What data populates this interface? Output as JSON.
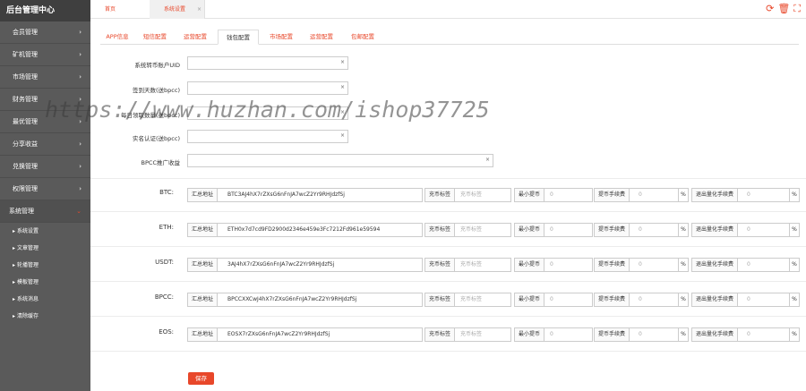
{
  "sidebar": {
    "title": "后台管理中心",
    "menu": [
      {
        "label": "会员管理",
        "icon": "chevron-right-icon"
      },
      {
        "label": "矿机管理",
        "icon": "chevron-right-icon"
      },
      {
        "label": "市场管理",
        "icon": "chevron-right-icon"
      },
      {
        "label": "财务管理",
        "icon": "chevron-right-icon"
      },
      {
        "label": "最优管理",
        "icon": "chevron-right-icon"
      },
      {
        "label": "分享收益",
        "icon": "chevron-right-icon"
      },
      {
        "label": "兑换管理",
        "icon": "chevron-right-icon"
      },
      {
        "label": "权限管理",
        "icon": "chevron-right-icon"
      },
      {
        "label": "系统管理",
        "icon": "chevron-down-icon"
      }
    ],
    "submenu": [
      "系统设置",
      "文章管理",
      "轮播管理",
      "模板管理",
      "系统消息",
      "清除缓存"
    ]
  },
  "topbar": {
    "tabs": [
      {
        "label": "首页"
      },
      {
        "label": "系统设置",
        "close": "×"
      }
    ],
    "icons": [
      "refresh-icon",
      "trash-icon",
      "fullscreen-icon"
    ]
  },
  "config_tabs": [
    "APP信息",
    "短信配置",
    "运营配置",
    "钱包配置",
    "市场配置",
    "运营配置",
    "包邮配置"
  ],
  "active_config_tab": "钱包配置",
  "form": {
    "clear_symbol": "×",
    "fields": [
      {
        "label": "系统转币账户UID",
        "value": ""
      },
      {
        "label": "签到天数(送bpcc)",
        "value": ""
      },
      {
        "label": "每日领取数量(送bpcc)",
        "value": ""
      },
      {
        "label": "实名认证(送bpcc)",
        "value": ""
      },
      {
        "label": "BPCC推广收益",
        "value": ""
      }
    ]
  },
  "coins": [
    {
      "name": "BTC:",
      "addr_label": "汇总地址",
      "address": "BTC3AJ4hX7rZXsG6nFnJA7wcZ2Yr9RHJdzfSj",
      "tag_label": "充币标签",
      "tag_placeholder": "充币标签",
      "min_label": "最小提币",
      "min_value": "0",
      "fee_label": "提币手续费",
      "fee_value": "0",
      "fee_unit": "%",
      "quant_label": "退出量化手续费",
      "quant_value": "0",
      "quant_unit": "%"
    },
    {
      "name": "ETH:",
      "addr_label": "汇总地址",
      "address": "ETH0x7d7cd9FD2900d2346e459e3Fc7212Fd961e59594",
      "tag_label": "充币标签",
      "tag_placeholder": "充币标签",
      "min_label": "最小提币",
      "min_value": "0",
      "fee_label": "提币手续费",
      "fee_value": "0",
      "fee_unit": "%",
      "quant_label": "退出量化手续费",
      "quant_value": "0",
      "quant_unit": "%"
    },
    {
      "name": "USDT:",
      "addr_label": "汇总地址",
      "address": "3AJ4hX7rZXsG6nFnJA7wcZ2Yr9RHJdzfSj",
      "tag_label": "充币标签",
      "tag_placeholder": "充币标签",
      "min_label": "最小提币",
      "min_value": "0",
      "fee_label": "提币手续费",
      "fee_value": "0",
      "fee_unit": "%",
      "quant_label": "退出量化手续费",
      "quant_value": "0",
      "quant_unit": "%"
    },
    {
      "name": "BPCC:",
      "addr_label": "汇总地址",
      "address": "BPCCXXCwJ4hX7rZXsG6nFnJA7wcZ2Yr9RHJdzfSj",
      "tag_label": "充币标签",
      "tag_placeholder": "充币标签",
      "min_label": "最小提币",
      "min_value": "0",
      "fee_label": "提币手续费",
      "fee_value": "0",
      "fee_unit": "%",
      "quant_label": "退出量化手续费",
      "quant_value": "0",
      "quant_unit": "%"
    },
    {
      "name": "EOS:",
      "addr_label": "汇总地址",
      "address": "EOSX7rZXsG6nFnJA7wcZ2Yr9RHJdzfSj",
      "tag_label": "充币标签",
      "tag_placeholder": "充币标签",
      "min_label": "最小提币",
      "min_value": "0",
      "fee_label": "提币手续费",
      "fee_value": "0",
      "fee_unit": "%",
      "quant_label": "退出量化手续费",
      "quant_value": "0",
      "quant_unit": "%"
    }
  ],
  "save_label": "保存",
  "watermark": "https://www.huzhan.com/ishop37725",
  "colors": {
    "accent": "#e8472a",
    "sidebar": "#5a5a5a",
    "sidebar_header": "#3f3f3f"
  }
}
